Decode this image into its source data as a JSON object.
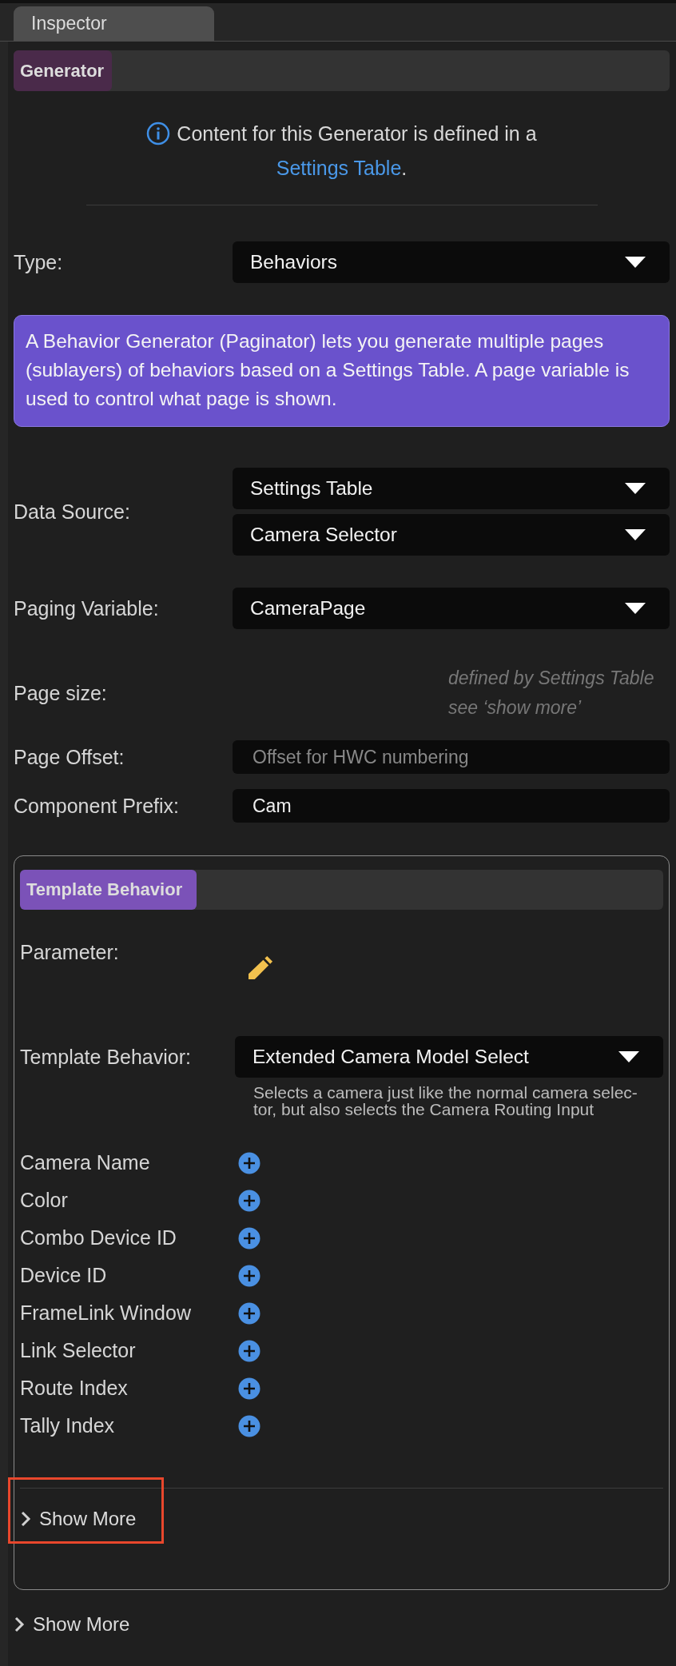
{
  "tab": {
    "label": "Inspector",
    "selected": true
  },
  "generator": {
    "header": "Generator",
    "info": {
      "text": "Content for this Generator is defined in a",
      "link": "Settings Table",
      "suffix": "."
    },
    "fields": [
      {
        "kind": "select",
        "label": "Type:",
        "values": [
          "Behaviors"
        ]
      },
      {
        "kind": "callout",
        "text": "A Behavior Generator (Paginator) lets you generate multiple pages (sublayers) of behaviors based on a Settings Table. A page variable is used to control what page is shown."
      },
      {
        "kind": "select",
        "label": "Data Source:",
        "values": [
          "Settings Table",
          "Camera Selector"
        ]
      },
      {
        "kind": "select",
        "label": "Paging Variable:",
        "values": [
          "CameraPage"
        ]
      },
      {
        "kind": "note",
        "label": "Page size:",
        "lines": [
          "defined by Settings Table",
          "see ‘show more’"
        ]
      },
      {
        "kind": "input",
        "label": "Page Offset:",
        "placeholder": "Offset for HWC numbering"
      },
      {
        "kind": "input",
        "label": "Component Prefix:",
        "value": "Cam"
      }
    ]
  },
  "template": {
    "header": "Template Behavior",
    "parameter_label": "Parameter:",
    "behavior_label": "Template Behavior:",
    "behavior_value": "Extended Camera Model Select",
    "description": [
      "Selects a camera just like the normal camera selec-",
      "tor, but also selects the Camera Routing Input"
    ],
    "params": [
      "Camera Name",
      "Color",
      "Combo Device ID",
      "Device ID",
      "FrameLink Window",
      "Link Selector",
      "Route Index",
      "Tally Index"
    ],
    "show_more": {
      "label": "Show More",
      "expanded": false,
      "highlighted": true
    }
  },
  "show_more": {
    "label": "Show More",
    "expanded": false
  }
}
